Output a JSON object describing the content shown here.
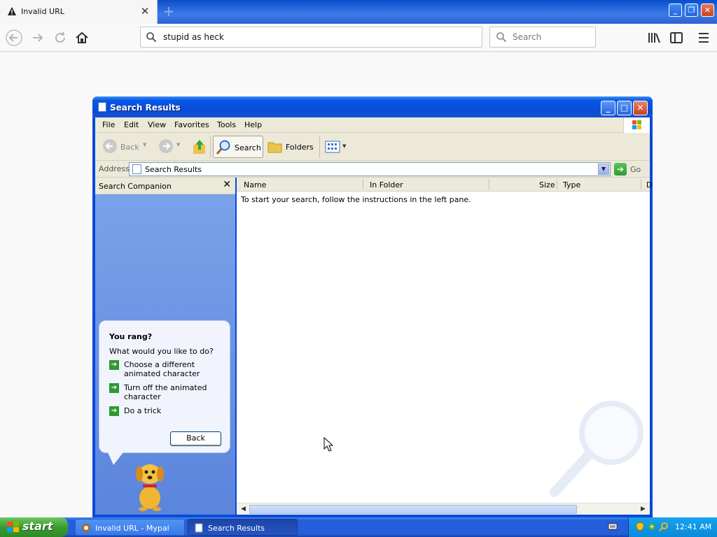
{
  "browser": {
    "tab_title": "Invalid URL",
    "url_value": "stupid as heck",
    "search_placeholder": "Search"
  },
  "window": {
    "title": "Search Results",
    "menu": [
      "File",
      "Edit",
      "View",
      "Favorites",
      "Tools",
      "Help"
    ],
    "toolbar": {
      "back": "Back",
      "search": "Search",
      "folders": "Folders"
    },
    "address": {
      "label": "Address",
      "value": "Search Results",
      "go": "Go"
    },
    "companion": {
      "header": "Search Companion",
      "question": "You rang?",
      "prompt": "What would you like to do?",
      "options": [
        "Choose a different animated character",
        "Turn off the animated character",
        "Do a trick"
      ],
      "back_button": "Back"
    },
    "results": {
      "columns": [
        "Name",
        "In Folder",
        "Size",
        "Type",
        "D"
      ],
      "message": "To start your search, follow the instructions in the left pane."
    }
  },
  "taskbar": {
    "start": "start",
    "tasks": [
      "Invalid URL - Mypal",
      "Search Results"
    ],
    "clock": "12:41 AM"
  }
}
